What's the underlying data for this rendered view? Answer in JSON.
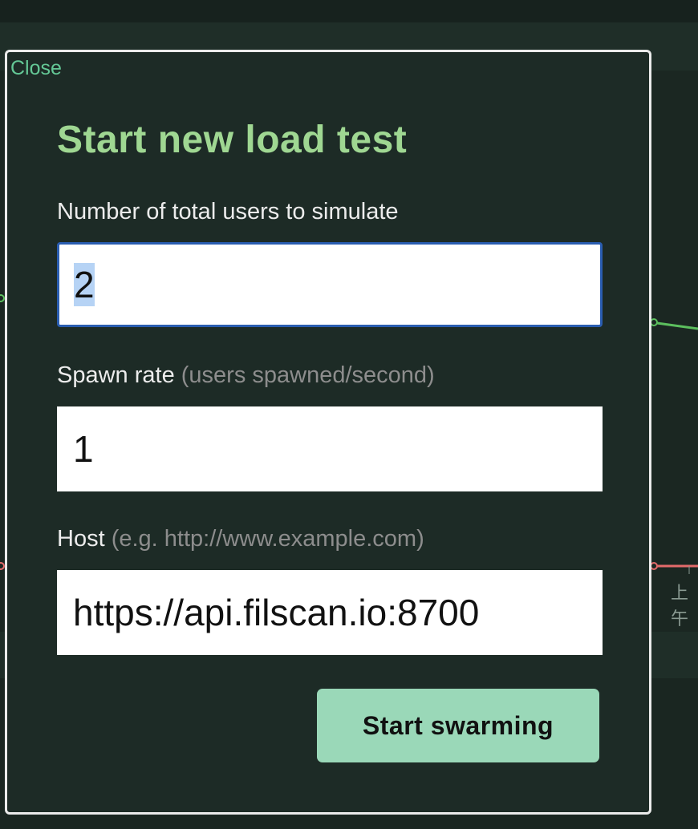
{
  "background": {
    "axis_label": "上午"
  },
  "modal": {
    "close_label": "Close",
    "title": "Start new load test",
    "users": {
      "label": "Number of total users to simulate",
      "value": "2"
    },
    "spawn_rate": {
      "label": "Spawn rate",
      "hint": "(users spawned/second)",
      "value": "1"
    },
    "host": {
      "label": "Host",
      "hint": "(e.g. http://www.example.com)",
      "value": "https://api.filscan.io:8700"
    },
    "start_button_label": "Start swarming"
  },
  "colors": {
    "title": "#9fd792",
    "close_link": "#64c896",
    "button": "#9ad8b8",
    "series_green": "#5cbf5e",
    "series_red": "#e36b6b"
  }
}
